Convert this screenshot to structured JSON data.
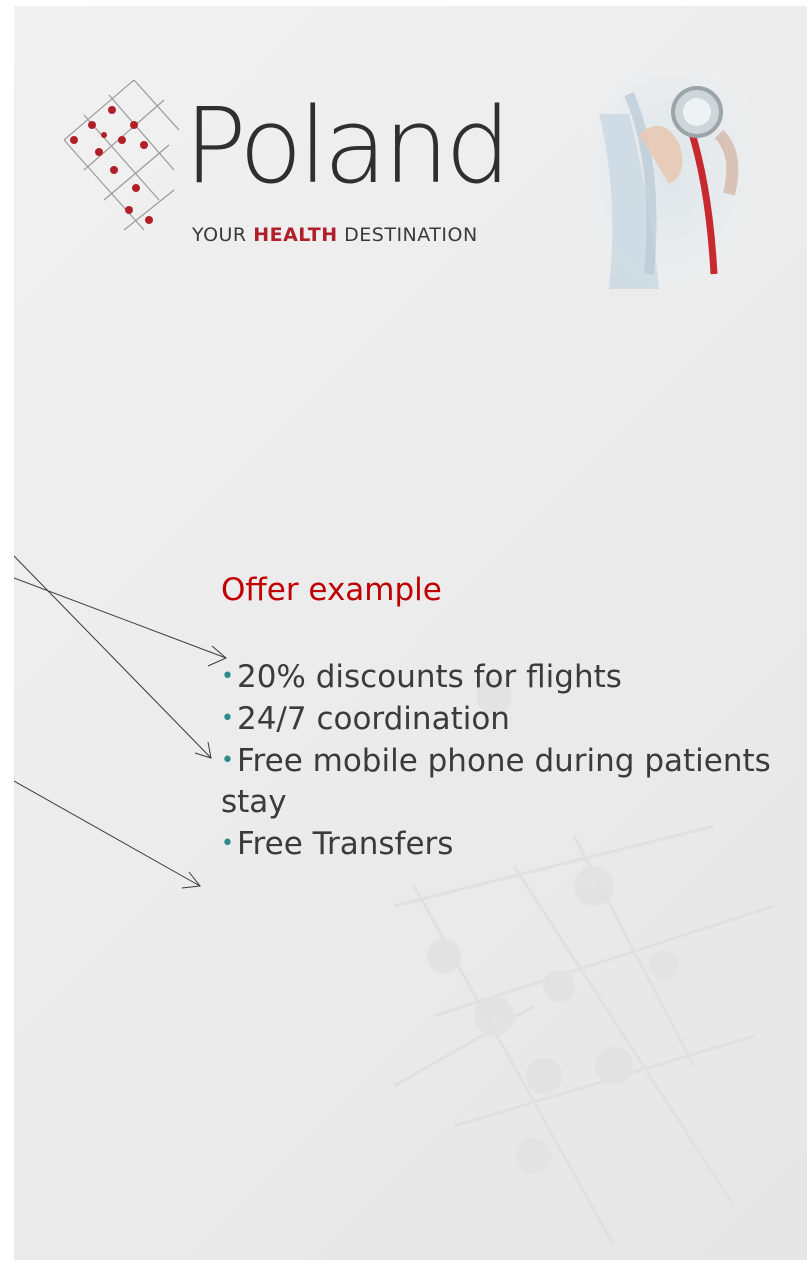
{
  "header": {
    "brand_name": "Poland",
    "tagline": {
      "part1": "YOUR",
      "highlight": "HEALTH",
      "part2": "DESTINATION"
    }
  },
  "offer": {
    "title": "Offer example",
    "bullet_symbol": "•",
    "items": [
      "20% discounts for flights",
      "24/7 coordination",
      "Free mobile phone during patients stay",
      "Free Transfers"
    ]
  },
  "colors": {
    "title_red": "#c00000",
    "brand_red": "#b11f2a",
    "bullet_teal": "#2e8b8b",
    "body_text": "#3b3b3b"
  },
  "icons": {
    "logo": "dotted-grid-logo-icon",
    "photo": "stethoscope-doctor-image"
  }
}
